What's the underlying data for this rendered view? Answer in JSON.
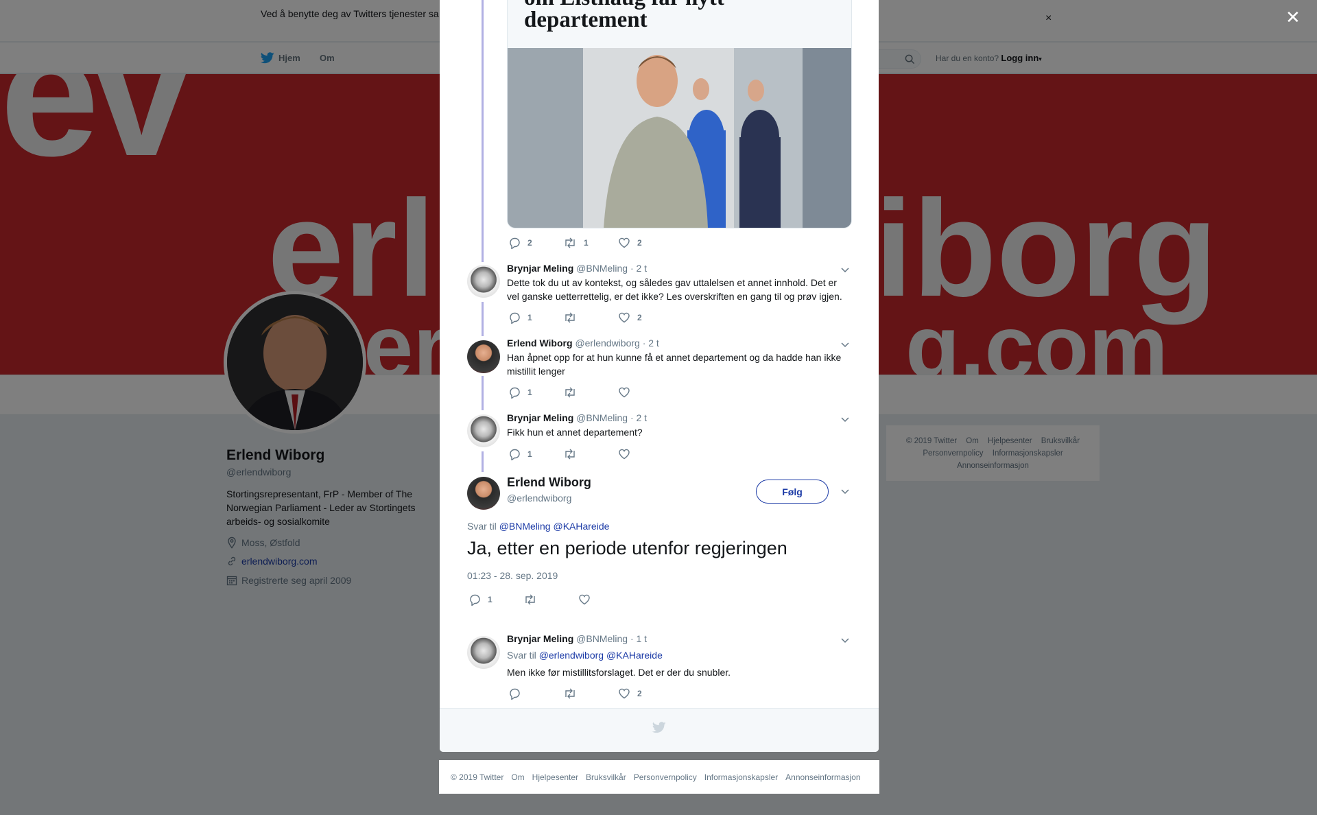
{
  "cookie_notice": {
    "text": "Ved å benytte deg av Twitters tjenester sa… informasjonskapsler til bl.a. analyser, personalisering og annonser.",
    "close_glyph": "×"
  },
  "topnav": {
    "home": "Hjem",
    "about": "Om",
    "account_prompt": "Har du en konto?",
    "login": "Logg inn"
  },
  "banner": {
    "big_word": "erl",
    "big_word_right": "iborg",
    "small_word": "er",
    "small_word_right": "g.com",
    "logo_text": "ev"
  },
  "profile": {
    "name": "Erlend Wiborg",
    "handle": "@erlendwiborg",
    "bio": "Stortingsrepresentant, FrP - Member of The Norwegian Parliament - Leder av Stortingets arbeids- og sosialkomite",
    "location": "Moss, Østfold",
    "website": "erlendwiborg.com",
    "joined": "Registrerte seg april 2009"
  },
  "side_footer": {
    "links": [
      "© 2019 Twitter",
      "Om",
      "Hjelpesenter",
      "Bruksvilkår",
      "Personvernpolicy",
      "Informasjonskapsler",
      "Annonseinformasjon"
    ]
  },
  "overlay_close": "✕",
  "modal": {
    "card": {
      "title_line1": "om Listhaug får nytt",
      "title_line2": "departement"
    },
    "card_actions": {
      "replies": "2",
      "retweets": "1",
      "likes": "2"
    },
    "replies": [
      {
        "name": "Brynjar Meling",
        "handle": "@BNMeling",
        "time": "· 2 t",
        "text": "Dette tok du ut av kontekst, og således gav uttalelsen et annet innhold.  Det er vel ganske uetterrettelig, er det ikke? Les overskriften en gang til og prøv igjen.",
        "replies": "1",
        "retweets": "",
        "likes": "2"
      },
      {
        "name": "Erlend Wiborg",
        "handle": "@erlendwiborg",
        "time": "· 2 t",
        "text": "Han åpnet opp for at hun kunne få et annet departement og da hadde han ikke mistillit lenger",
        "replies": "1",
        "retweets": "",
        "likes": ""
      },
      {
        "name": "Brynjar Meling",
        "handle": "@BNMeling",
        "time": "· 2 t",
        "text": "Fikk hun et annet departement?",
        "replies": "1",
        "retweets": "",
        "likes": ""
      }
    ],
    "main_tweet": {
      "name": "Erlend Wiborg",
      "handle": "@erlendwiborg",
      "follow": "Følg",
      "reply_to_label": "Svar til",
      "reply_to_1": "@BNMeling",
      "reply_to_2": "@KAHareide",
      "text": "Ja, etter en periode utenfor regjeringen",
      "timestamp": "01:23 - 28. sep. 2019",
      "replies": "1",
      "retweets": "",
      "likes": ""
    },
    "last_reply": {
      "name": "Brynjar Meling",
      "handle": "@BNMeling",
      "time": "· 1 t",
      "reply_to_label": "Svar til",
      "reply_to_1": "@erlendwiborg",
      "reply_to_2": "@KAHareide",
      "text": "Men ikke før mistillitsforslaget. Det er der du snubler.",
      "replies": "",
      "retweets": "",
      "likes": "2"
    }
  },
  "bottom_footer": {
    "links": [
      "© 2019 Twitter",
      "Om",
      "Hjelpesenter",
      "Bruksvilkår",
      "Personvernpolicy",
      "Informasjonskapsler",
      "Annonseinformasjon"
    ]
  },
  "colors": {
    "link_blue": "#1b3aa6",
    "banner_red": "#c8282d",
    "thread_line": "#b1b0e3",
    "twitter_blue": "#1da1f2"
  }
}
